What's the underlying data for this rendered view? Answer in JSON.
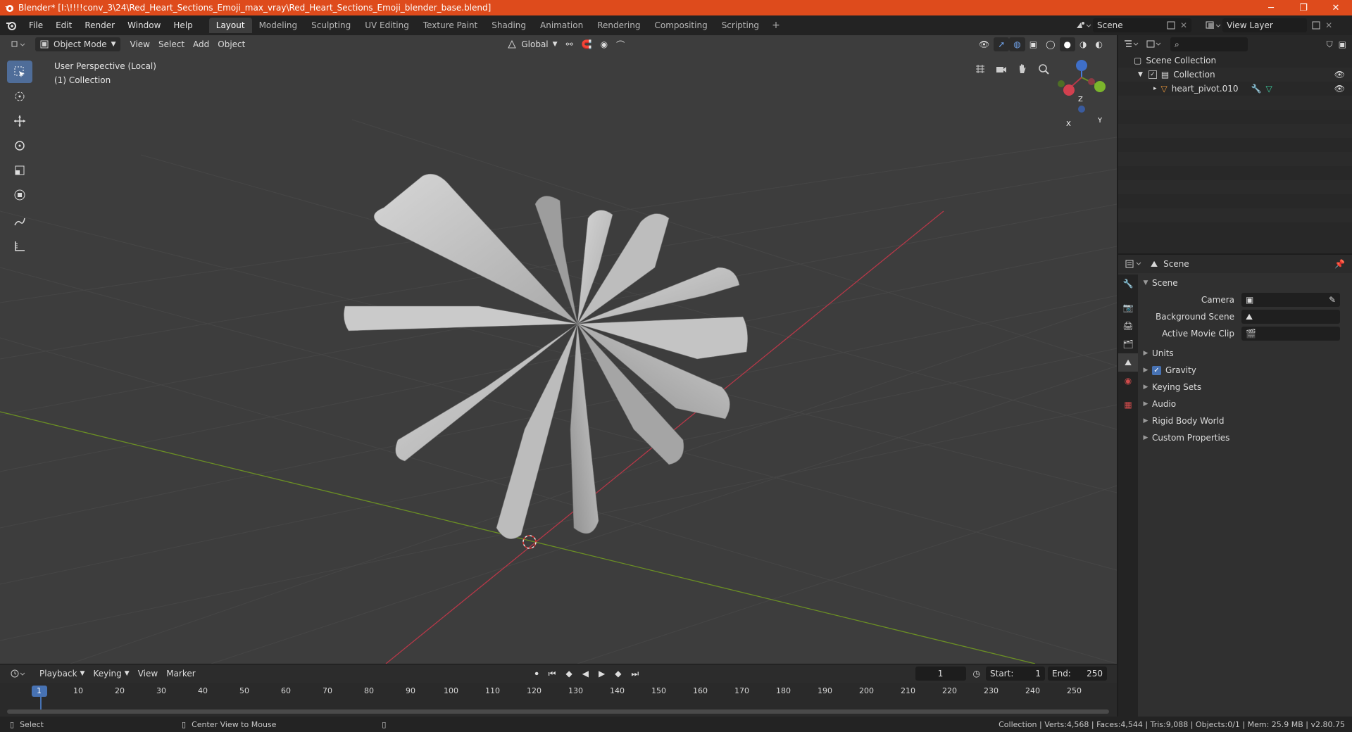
{
  "window": {
    "title": "Blender* [I:\\!!!!conv_3\\24\\Red_Heart_Sections_Emoji_max_vray\\Red_Heart_Sections_Emoji_blender_base.blend]",
    "minimize": "─",
    "maximize": "❐",
    "close": "✕"
  },
  "menu": [
    "File",
    "Edit",
    "Render",
    "Window",
    "Help"
  ],
  "workspaces": [
    "Layout",
    "Modeling",
    "Sculpting",
    "UV Editing",
    "Texture Paint",
    "Shading",
    "Animation",
    "Rendering",
    "Compositing",
    "Scripting"
  ],
  "active_workspace": "Layout",
  "scene_name": "Scene",
  "view_layer": "View Layer",
  "viewport": {
    "mode": "Object Mode",
    "menus": [
      "View",
      "Select",
      "Add",
      "Object"
    ],
    "orientation": "Global",
    "info_line1": "User Perspective (Local)",
    "info_line2": "(1) Collection",
    "gizmo": {
      "x": "X",
      "y": "Y",
      "z": "Z"
    }
  },
  "timeline": {
    "menus": [
      "Playback",
      "Keying",
      "View",
      "Marker"
    ],
    "current_frame": "1",
    "start_label": "Start:",
    "start": "1",
    "end_label": "End:",
    "end": "250",
    "ruler": [
      "1",
      "10",
      "20",
      "30",
      "40",
      "50",
      "60",
      "70",
      "80",
      "90",
      "100",
      "110",
      "120",
      "130",
      "140",
      "150",
      "160",
      "170",
      "180",
      "190",
      "200",
      "210",
      "220",
      "230",
      "240",
      "250"
    ]
  },
  "status": {
    "select": "Select",
    "center_view": "Center View to Mouse",
    "stats": "Collection | Verts:4,568 | Faces:4,544 | Tris:9,088 | Objects:0/1 | Mem: 25.9 MB | v2.80.75"
  },
  "outliner": {
    "scene_collection": "Scene Collection",
    "collection": "Collection",
    "object": "heart_pivot.010"
  },
  "properties": {
    "header": "Scene",
    "section": "Scene",
    "camera_label": "Camera",
    "background_scene_label": "Background Scene",
    "active_movie_clip_label": "Active Movie Clip",
    "panels": [
      "Units",
      "Gravity",
      "Keying Sets",
      "Audio",
      "Rigid Body World",
      "Custom Properties"
    ]
  },
  "colors": {
    "title_bar": "#de4b1c",
    "active_tool": "#4f6d99",
    "x_axis": "#b63848",
    "y_axis": "#6b8f24",
    "accent_blue": "#4772b3"
  }
}
